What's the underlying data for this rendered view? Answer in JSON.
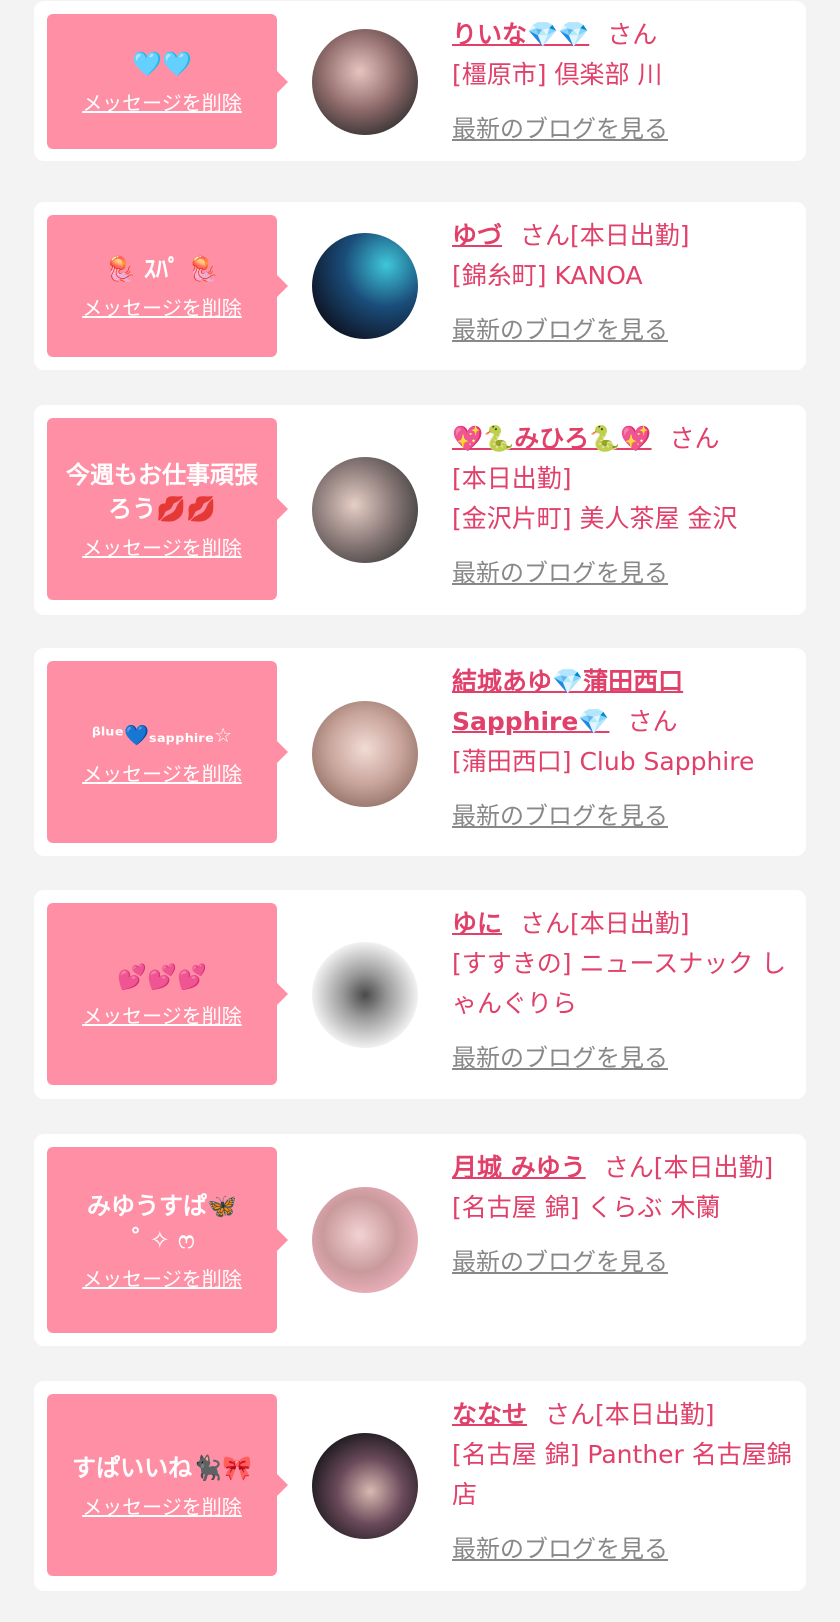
{
  "delete_label": "メッセージを削除",
  "blog_label": "最新のブログを見る",
  "san": "さん",
  "cards": [
    {
      "message": "🩵🩵",
      "name": "りいな💎💎",
      "status": "",
      "shop": "[橿原市] 倶楽部 川"
    },
    {
      "message": "🪼 ｽﾊﾟ 🪼",
      "name": "ゆづ",
      "status": "[本日出勤]",
      "shop": "[錦糸町] KANOA"
    },
    {
      "message": "今週もお仕事頑張\nろう💋💋",
      "name": "💖🐍みひろ🐍💖",
      "status": "[本日出勤]",
      "shop": "[金沢片町] 美人茶屋 金沢"
    },
    {
      "message": "ᵝˡᵘᵉ💙ₛₐₚₚₕᵢᵣₑ☆",
      "name": "結城あゆ💎蒲田西口\nSapphire💎",
      "status": "",
      "shop": "[蒲田西口] Club Sapphire"
    },
    {
      "message": "💕💕💕",
      "name": "ゆに",
      "status": "[本日出勤]",
      "shop": "[すすきの] ニュースナック しゃんぐりら"
    },
    {
      "message": "みゆうすぱ🦋\n˚ ✧ ෆ",
      "name": "月城 みゆう",
      "status": "[本日出勤]",
      "shop": "[名古屋 錦] くらぶ 木蘭"
    },
    {
      "message": "すぱいいね🐈‍⬛🎀",
      "name": "ななせ",
      "status": "[本日出勤]",
      "shop": "[名古屋 錦] Panther 名古屋錦店"
    }
  ],
  "colors": {
    "accent": "#e0406a",
    "bubble": "#ff8fa4",
    "link_gray": "#888888",
    "background": "#f3f3f3"
  }
}
